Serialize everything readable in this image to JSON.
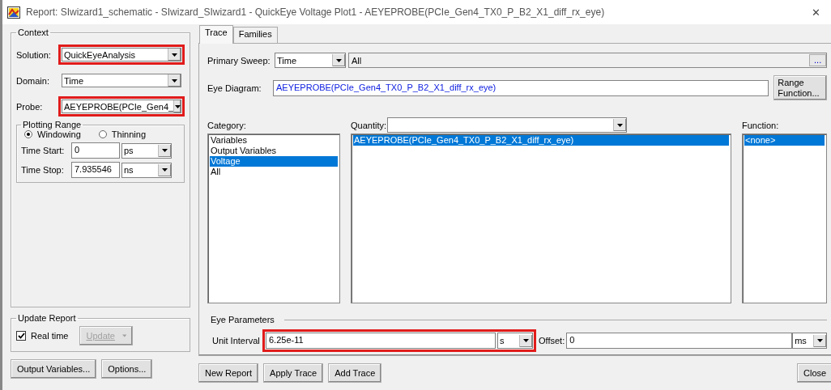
{
  "window": {
    "title": "Report: SIwizard1_schematic - SIwizard_SIwizard1 - QuickEye Voltage Plot1 - AEYEPROBE(PCIe_Gen4_TX0_P_B2_X1_diff_rx_eye)",
    "close": "✕"
  },
  "context": {
    "title": "Context",
    "fields": [
      {
        "label": "Solution:",
        "value": "QuickEyeAnalysis",
        "highlighted": true
      },
      {
        "label": "Domain:",
        "value": "Time",
        "highlighted": false
      },
      {
        "label": "Probe:",
        "value": "AEYEPROBE(PCIe_Gen4_",
        "highlighted": true
      }
    ],
    "plotting_range": {
      "title": "Plotting Range",
      "modes": [
        {
          "label": "Windowing",
          "selected": true
        },
        {
          "label": "Thinning",
          "selected": false
        }
      ],
      "times": [
        {
          "label": "Time Start:",
          "value": "0",
          "unit": "ps"
        },
        {
          "label": "Time Stop:",
          "value": "7.935546",
          "unit": "ns"
        }
      ]
    }
  },
  "update_report": {
    "title": "Update Report",
    "real_time": {
      "label": "Real time",
      "checked": true
    },
    "update_button": {
      "label": "Update",
      "disabled": true
    }
  },
  "left_buttons": [
    "Output Variables...",
    "Options..."
  ],
  "tabs": [
    {
      "label": "Trace",
      "selected": true
    },
    {
      "label": "Families",
      "selected": false
    }
  ],
  "trace": {
    "primary_sweep": {
      "label": "Primary Sweep:",
      "value": "Time",
      "range": "All",
      "browse": "..."
    },
    "eye_diagram": {
      "label": "Eye Diagram:",
      "value": "AEYEPROBE(PCIe_Gen4_TX0_P_B2_X1_diff_rx_eye)",
      "button": "Range Function..."
    },
    "category": {
      "label": "Category:",
      "items": [
        {
          "label": "Variables",
          "selected": false
        },
        {
          "label": "Output Variables",
          "selected": false
        },
        {
          "label": "Voltage",
          "selected": true
        },
        {
          "label": "All",
          "selected": false
        }
      ]
    },
    "quantity": {
      "label": "Quantity:",
      "items": [
        {
          "label": "AEYEPROBE(PCIe_Gen4_TX0_P_B2_X1_diff_rx_eye)",
          "selected": true
        }
      ]
    },
    "function": {
      "label": "Function:",
      "items": [
        {
          "label": "<none>",
          "selected": true
        }
      ]
    },
    "eye_parameters": {
      "title": "Eye Parameters",
      "unit_interval": {
        "label": "Unit Interval",
        "value": "6.25e-11",
        "unit": "s",
        "highlighted": true
      },
      "offset": {
        "label": "Offset:",
        "value": "0",
        "unit": "ms"
      }
    }
  },
  "actions": [
    "New Report",
    "Apply Trace",
    "Add Trace"
  ],
  "close_button": "Close"
}
